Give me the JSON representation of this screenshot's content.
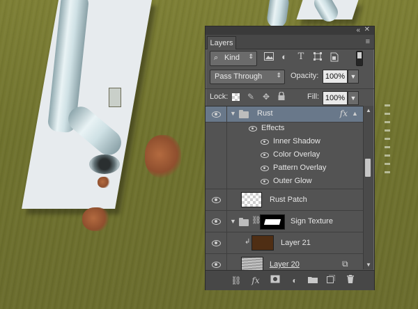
{
  "panel": {
    "title": "Layers",
    "collapse_glyph": "«",
    "close_glyph": "✕",
    "menu_glyph": "≡"
  },
  "filter": {
    "kind_label": "Kind",
    "icons": [
      "image-filter-icon",
      "adjustment-filter-icon",
      "type-filter-icon",
      "shape-filter-icon",
      "smart-object-filter-icon"
    ]
  },
  "blend": {
    "mode": "Pass Through",
    "opacity_label": "Opacity:",
    "opacity_value": "100%",
    "lock_label": "Lock:",
    "fill_label": "Fill:",
    "fill_value": "100%"
  },
  "layers": {
    "rust": {
      "name": "Rust",
      "fx": "fx"
    },
    "effects": {
      "label": "Effects",
      "items": [
        "Inner Shadow",
        "Color Overlay",
        "Pattern Overlay",
        "Outer Glow"
      ]
    },
    "rust_patch": {
      "name": "Rust Patch"
    },
    "sign_texture": {
      "name": "Sign Texture"
    },
    "layer21": {
      "name": "Layer 21"
    },
    "layer20": {
      "name": "Layer 20"
    }
  },
  "colors": {
    "panel_bg": "#535353",
    "selected_row": "#69788a",
    "canvas_green": "#737630",
    "layer21_swatch": "#4f2e14"
  }
}
